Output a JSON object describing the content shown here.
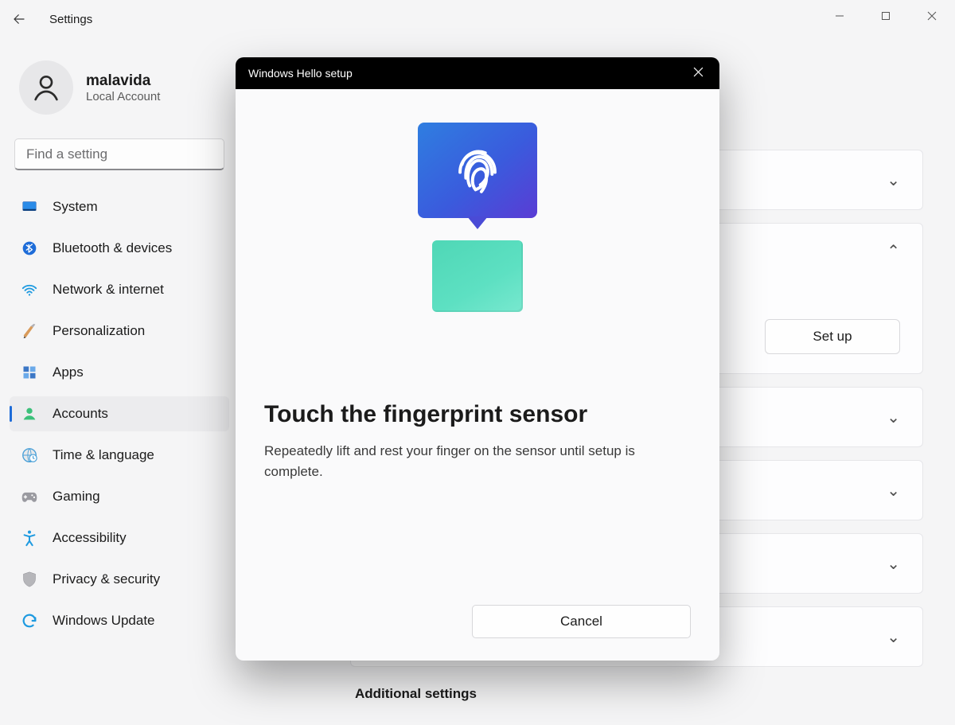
{
  "titlebar": {
    "title": "Settings"
  },
  "profile": {
    "name": "malavida",
    "subtitle": "Local Account"
  },
  "search": {
    "placeholder": "Find a setting"
  },
  "sidebar": {
    "items": [
      {
        "label": "System"
      },
      {
        "label": "Bluetooth & devices"
      },
      {
        "label": "Network & internet"
      },
      {
        "label": "Personalization"
      },
      {
        "label": "Apps"
      },
      {
        "label": "Accounts"
      },
      {
        "label": "Time & language"
      },
      {
        "label": "Gaming"
      },
      {
        "label": "Accessibility"
      },
      {
        "label": "Privacy & security"
      },
      {
        "label": "Windows Update"
      }
    ]
  },
  "content": {
    "setup_button": "Set up",
    "additional_settings": "Additional settings"
  },
  "modal": {
    "title": "Windows Hello setup",
    "heading": "Touch the fingerprint sensor",
    "description": "Repeatedly lift and rest your finger on the sensor until setup is complete.",
    "cancel": "Cancel"
  }
}
